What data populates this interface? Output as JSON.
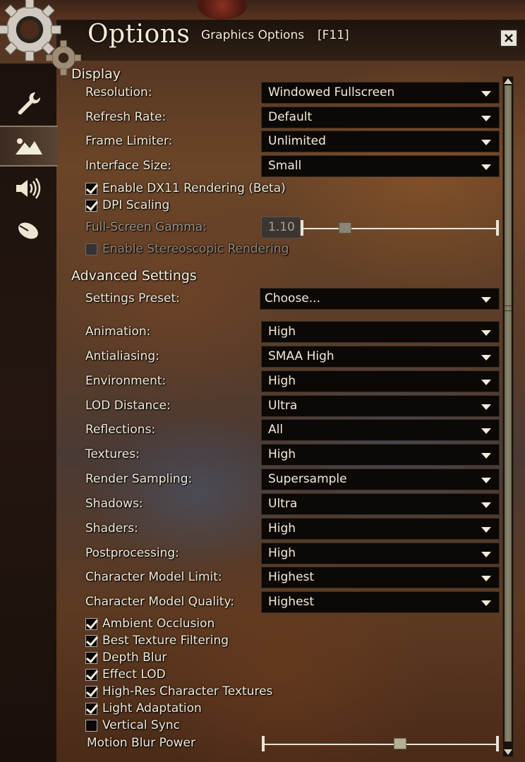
{
  "window": {
    "title": "Options",
    "subtitle": "Graphics Options",
    "hotkey": "[F11]"
  },
  "tabs": [
    {
      "name": "general-tab",
      "icon": "wrench-icon"
    },
    {
      "name": "graphics-tab",
      "icon": "mountains-icon",
      "active": true
    },
    {
      "name": "sound-tab",
      "icon": "speaker-icon"
    },
    {
      "name": "controls-tab",
      "icon": "mouse-icon"
    }
  ],
  "display": {
    "heading": "Display",
    "resolution": {
      "label": "Resolution:",
      "value": "Windowed Fullscreen"
    },
    "refresh_rate": {
      "label": "Refresh Rate:",
      "value": "Default"
    },
    "frame_limiter": {
      "label": "Frame Limiter:",
      "value": "Unlimited"
    },
    "interface_size": {
      "label": "Interface Size:",
      "value": "Small"
    },
    "dx11": {
      "label": "Enable DX11 Rendering (Beta)",
      "checked": true
    },
    "dpi_scaling": {
      "label": "DPI Scaling",
      "checked": true
    },
    "gamma": {
      "label": "Full-Screen Gamma:",
      "value": "1.10",
      "level": 0.22
    },
    "stereoscopic": {
      "label": "Enable Stereoscopic Rendering",
      "checked": false,
      "disabled": true
    }
  },
  "advanced": {
    "heading": "Advanced Settings",
    "preset": {
      "label": "Settings Preset:",
      "value": "Choose..."
    },
    "animation": {
      "label": "Animation:",
      "value": "High"
    },
    "antialiasing": {
      "label": "Antialiasing:",
      "value": "SMAA High"
    },
    "environment": {
      "label": "Environment:",
      "value": "High"
    },
    "lod_distance": {
      "label": "LOD Distance:",
      "value": "Ultra"
    },
    "reflections": {
      "label": "Reflections:",
      "value": "All"
    },
    "textures": {
      "label": "Textures:",
      "value": "High"
    },
    "render_sampling": {
      "label": "Render Sampling:",
      "value": "Supersample"
    },
    "shadows": {
      "label": "Shadows:",
      "value": "Ultra"
    },
    "shaders": {
      "label": "Shaders:",
      "value": "High"
    },
    "postprocessing": {
      "label": "Postprocessing:",
      "value": "High"
    },
    "char_model_limit": {
      "label": "Character Model Limit:",
      "value": "Highest"
    },
    "char_model_quality": {
      "label": "Character Model Quality:",
      "value": "Highest"
    },
    "ambient_occlusion": {
      "label": "Ambient Occlusion",
      "checked": true
    },
    "best_texture_filtering": {
      "label": "Best Texture Filtering",
      "checked": true
    },
    "depth_blur": {
      "label": "Depth Blur",
      "checked": true
    },
    "effect_lod": {
      "label": "Effect LOD",
      "checked": true
    },
    "high_res_char_textures": {
      "label": "High-Res Character Textures",
      "checked": true
    },
    "light_adaptation": {
      "label": "Light Adaptation",
      "checked": true
    },
    "vertical_sync": {
      "label": "Vertical Sync",
      "checked": false
    },
    "motion_blur": {
      "label": "Motion Blur Power",
      "level": 0.59
    }
  },
  "colors": {
    "text": "#f1ead8",
    "dropdown_bg": "#0b0806",
    "slider_thumb": "#b4b094"
  }
}
